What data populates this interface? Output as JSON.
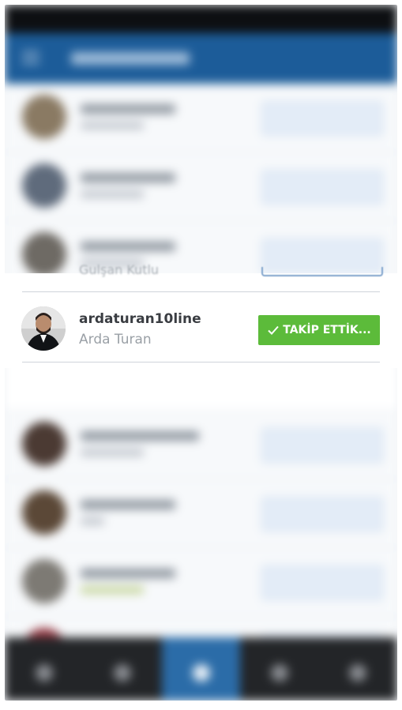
{
  "focused_user": {
    "username": "ardaturan10line",
    "full_name": "Arda Turan",
    "follow_button_label": "TAKİP ETTİK...",
    "follow_button_color": "#5cbb3a"
  },
  "above_user_peek": {
    "full_name": "Gulşan Kutlu"
  },
  "colors": {
    "app_bar": "#1c5c99",
    "bottom_nav": "#232528",
    "active_tab": "#2b6ca8"
  },
  "bottom_nav": {
    "tabs": [
      "home-icon",
      "search-icon",
      "camera-icon",
      "activity-icon",
      "profile-icon"
    ],
    "active_index": 2
  }
}
